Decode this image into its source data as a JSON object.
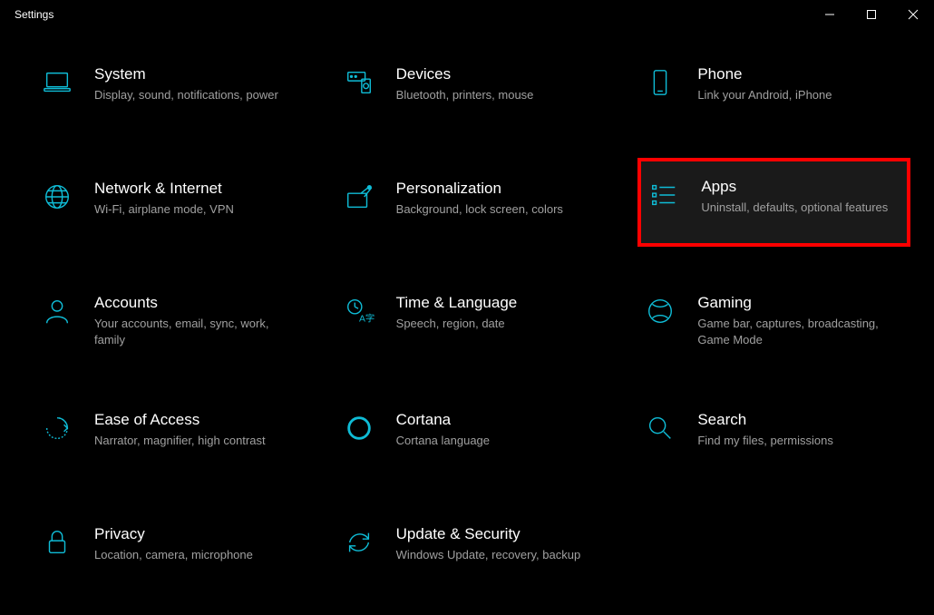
{
  "window": {
    "title": "Settings"
  },
  "categories": [
    {
      "id": "system",
      "title": "System",
      "desc": "Display, sound, notifications, power",
      "icon": "laptop-icon"
    },
    {
      "id": "devices",
      "title": "Devices",
      "desc": "Bluetooth, printers, mouse",
      "icon": "devices-icon"
    },
    {
      "id": "phone",
      "title": "Phone",
      "desc": "Link your Android, iPhone",
      "icon": "phone-icon"
    },
    {
      "id": "network",
      "title": "Network & Internet",
      "desc": "Wi-Fi, airplane mode, VPN",
      "icon": "globe-icon"
    },
    {
      "id": "personalization",
      "title": "Personalization",
      "desc": "Background, lock screen, colors",
      "icon": "brush-icon"
    },
    {
      "id": "apps",
      "title": "Apps",
      "desc": "Uninstall, defaults, optional features",
      "icon": "apps-icon",
      "highlighted": true
    },
    {
      "id": "accounts",
      "title": "Accounts",
      "desc": "Your accounts, email, sync, work, family",
      "icon": "person-icon"
    },
    {
      "id": "time",
      "title": "Time & Language",
      "desc": "Speech, region, date",
      "icon": "time-lang-icon"
    },
    {
      "id": "gaming",
      "title": "Gaming",
      "desc": "Game bar, captures, broadcasting, Game Mode",
      "icon": "xbox-icon"
    },
    {
      "id": "ease",
      "title": "Ease of Access",
      "desc": "Narrator, magnifier, high contrast",
      "icon": "ease-icon"
    },
    {
      "id": "cortana",
      "title": "Cortana",
      "desc": "Cortana language",
      "icon": "cortana-icon"
    },
    {
      "id": "search",
      "title": "Search",
      "desc": "Find my files, permissions",
      "icon": "search-icon"
    },
    {
      "id": "privacy",
      "title": "Privacy",
      "desc": "Location, camera, microphone",
      "icon": "lock-icon"
    },
    {
      "id": "update",
      "title": "Update & Security",
      "desc": "Windows Update, recovery, backup",
      "icon": "update-icon"
    }
  ]
}
